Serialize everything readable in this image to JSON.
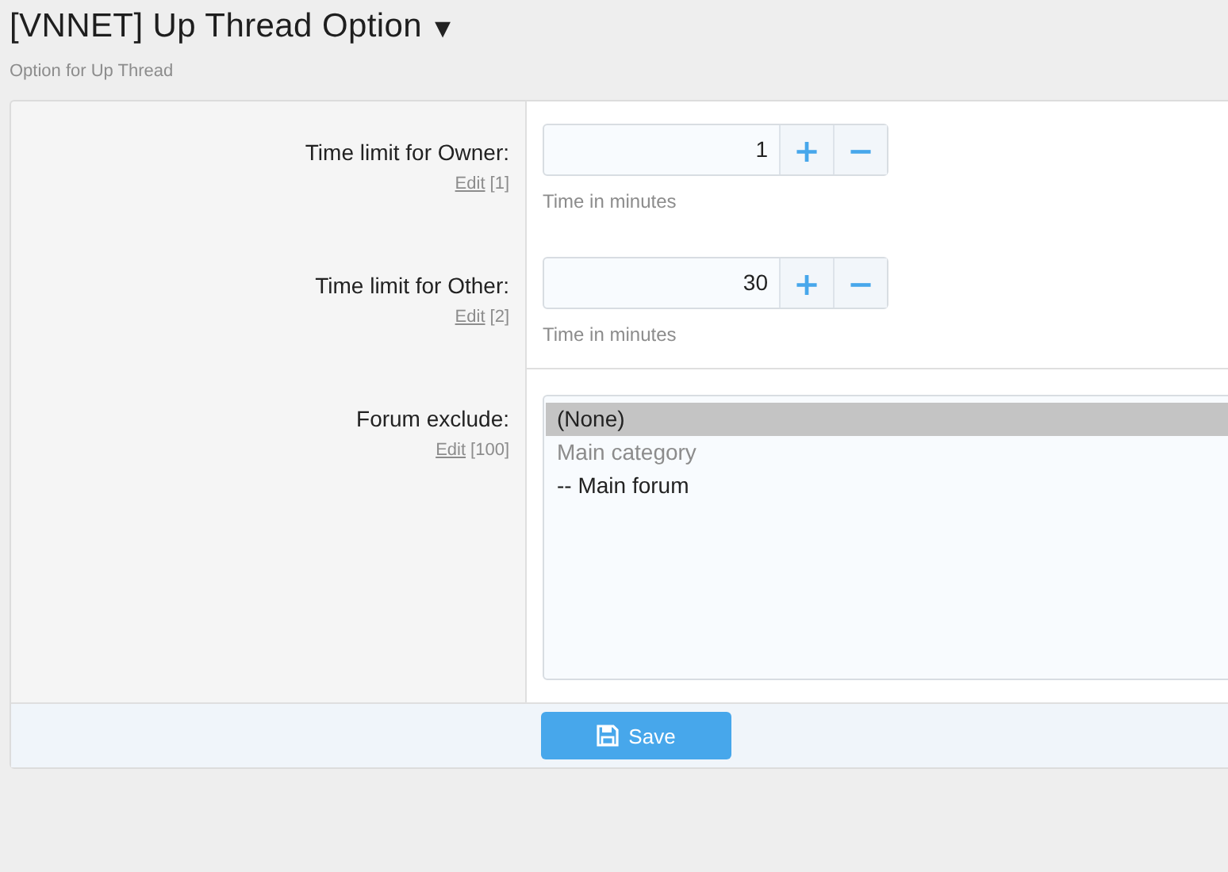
{
  "header": {
    "title": "[VNNET] Up Thread Option",
    "caret": "▾",
    "description": "Option for Up Thread"
  },
  "options": [
    {
      "kind": "number",
      "label": "Time limit for Owner:",
      "edit": "Edit",
      "order": "[1]",
      "value": "1",
      "plus": "+",
      "minus": "−",
      "hint": "Time in minutes"
    },
    {
      "kind": "number",
      "label": "Time limit for Other:",
      "edit": "Edit",
      "order": "[2]",
      "value": "30",
      "plus": "+",
      "minus": "−",
      "hint": "Time in minutes"
    },
    {
      "kind": "select",
      "label": "Forum exclude:",
      "edit": "Edit",
      "order": "[100]",
      "items": [
        {
          "text": "(None)",
          "selected": true,
          "disabled": false
        },
        {
          "text": "Main category",
          "selected": false,
          "disabled": true
        },
        {
          "text": "-- Main forum",
          "selected": false,
          "disabled": false
        }
      ]
    }
  ],
  "save": "Save"
}
